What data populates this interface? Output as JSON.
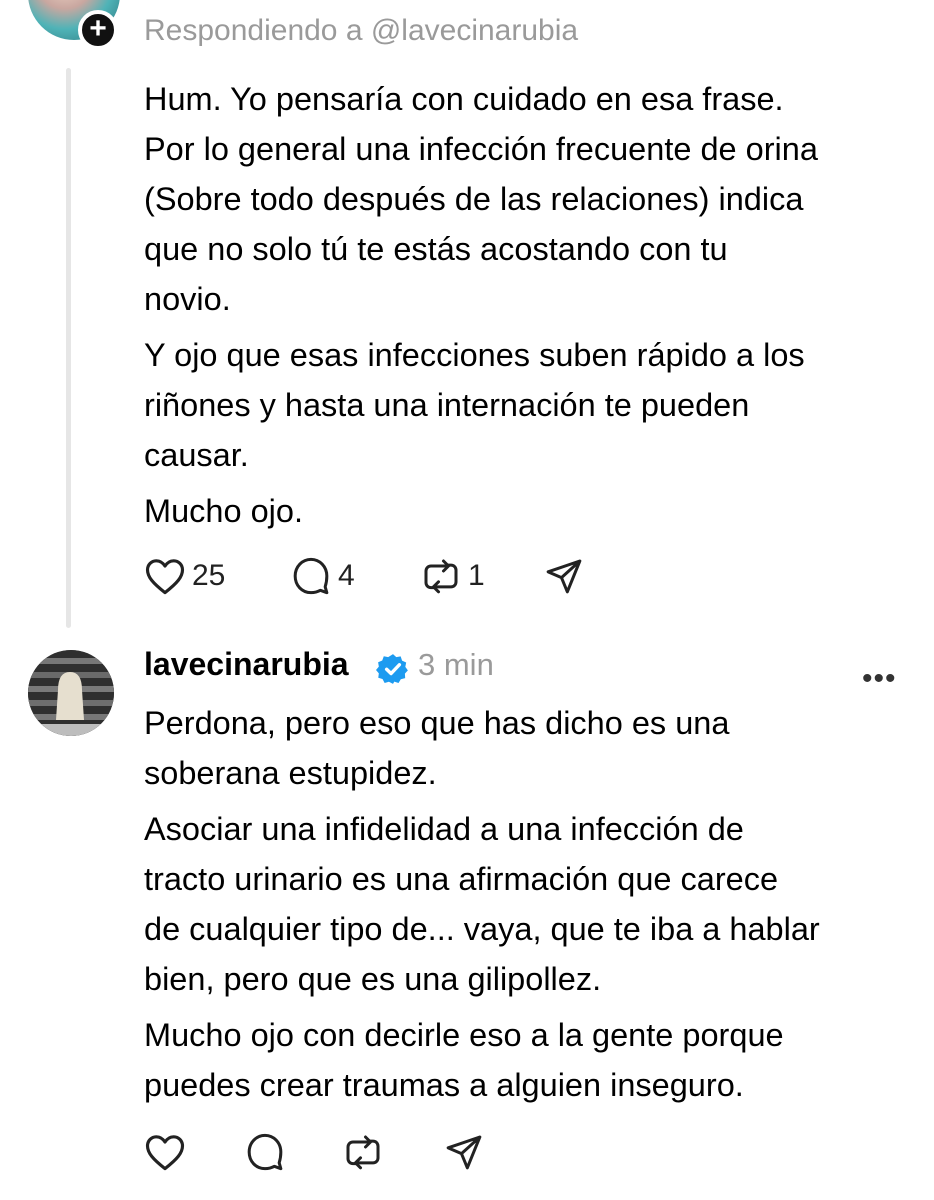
{
  "reply_context": {
    "label": "Respondiendo a @lavecinarubia"
  },
  "post1": {
    "paragraphs": [
      "Hum. Yo pensaría con cuidado en esa frase. Por lo general una infección frecuente de orina (Sobre todo después de las relaciones) indica que no solo tú te estás acostando con tu novio.",
      "Y ojo que esas infecciones suben rápido a los riñones y hasta una internación te pueden causar.",
      "Mucho ojo."
    ],
    "lines": [
      [
        "Hum. Yo pensaría con cuidado en esa frase.",
        "Por lo general una infección frecuente de orina",
        "(Sobre todo después de las relaciones) indica",
        "que no solo tú te estás acostando con tu",
        "novio."
      ],
      [
        "Y ojo que esas infecciones suben rápido a los",
        "riñones y hasta una internación te pueden",
        "causar."
      ],
      [
        "Mucho ojo."
      ]
    ],
    "likes": "25",
    "comments": "4",
    "reposts": "1"
  },
  "post2": {
    "username": "lavecinarubia",
    "time": "3 min",
    "more_label": "•••",
    "lines": [
      [
        "Perdona, pero eso que has dicho es una",
        "soberana estupidez."
      ],
      [
        "Asociar una infidelidad a una infección de",
        "tracto urinario es una afirmación que carece",
        "de cualquier tipo de... vaya, que te iba a hablar",
        "bien, pero que es una gilipollez."
      ],
      [
        "Mucho ojo con decirle eso a la gente porque",
        "puedes crear traumas a alguien inseguro."
      ]
    ]
  },
  "icons": {
    "like": "heart-icon",
    "comment": "comment-bubble-icon",
    "repost": "repost-icon",
    "share": "send-icon",
    "verified": "verified-badge-icon",
    "add": "plus-icon"
  },
  "colors": {
    "secondary_text": "#9a9a9a",
    "verified_blue": "#1d9bf0",
    "thread_line": "#e6e6e6"
  }
}
